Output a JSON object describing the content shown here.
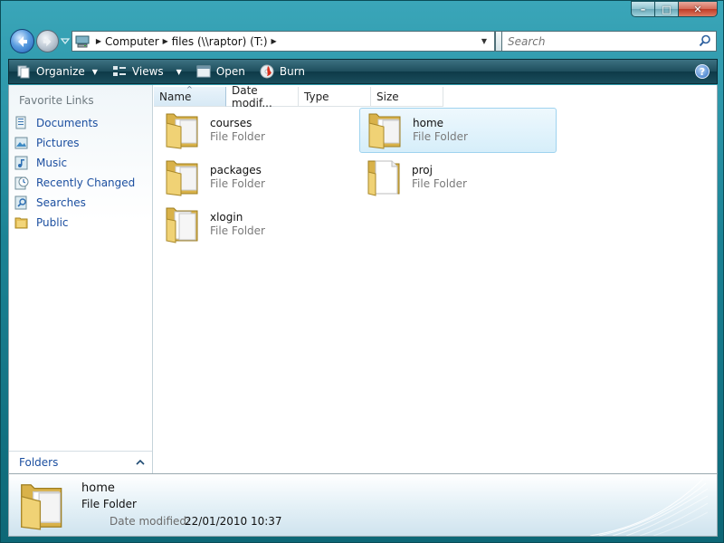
{
  "window": {
    "controls": {
      "minimize": "–",
      "maximize": "□",
      "close": "✕"
    }
  },
  "address": {
    "segments": [
      "Computer",
      "files (\\\\raptor) (T:)"
    ]
  },
  "search": {
    "placeholder": "Search"
  },
  "commands": {
    "organize": "Organize",
    "views": "Views",
    "open": "Open",
    "burn": "Burn",
    "help": "?"
  },
  "sidebar": {
    "header": "Favorite Links",
    "items": [
      {
        "label": "Documents",
        "icon": "documents-icon"
      },
      {
        "label": "Pictures",
        "icon": "pictures-icon"
      },
      {
        "label": "Music",
        "icon": "music-icon"
      },
      {
        "label": "Recently Changed",
        "icon": "recently-changed-icon"
      },
      {
        "label": "Searches",
        "icon": "searches-icon"
      },
      {
        "label": "Public",
        "icon": "public-folder-icon"
      }
    ],
    "folders_label": "Folders"
  },
  "columns": [
    "Name",
    "Date modif...",
    "Type",
    "Size"
  ],
  "files": [
    {
      "name": "courses",
      "type": "File Folder"
    },
    {
      "name": "home",
      "type": "File Folder",
      "selected": true
    },
    {
      "name": "packages",
      "type": "File Folder"
    },
    {
      "name": "proj",
      "type": "File Folder"
    },
    {
      "name": "xlogin",
      "type": "File Folder"
    }
  ],
  "details": {
    "name": "home",
    "type": "File Folder",
    "date_label": "Date modified:",
    "date_value": "22/01/2010 10:37"
  },
  "colors": {
    "frame": "#1b8294",
    "link": "#1c4fa0",
    "selection": "#d6eefa"
  }
}
